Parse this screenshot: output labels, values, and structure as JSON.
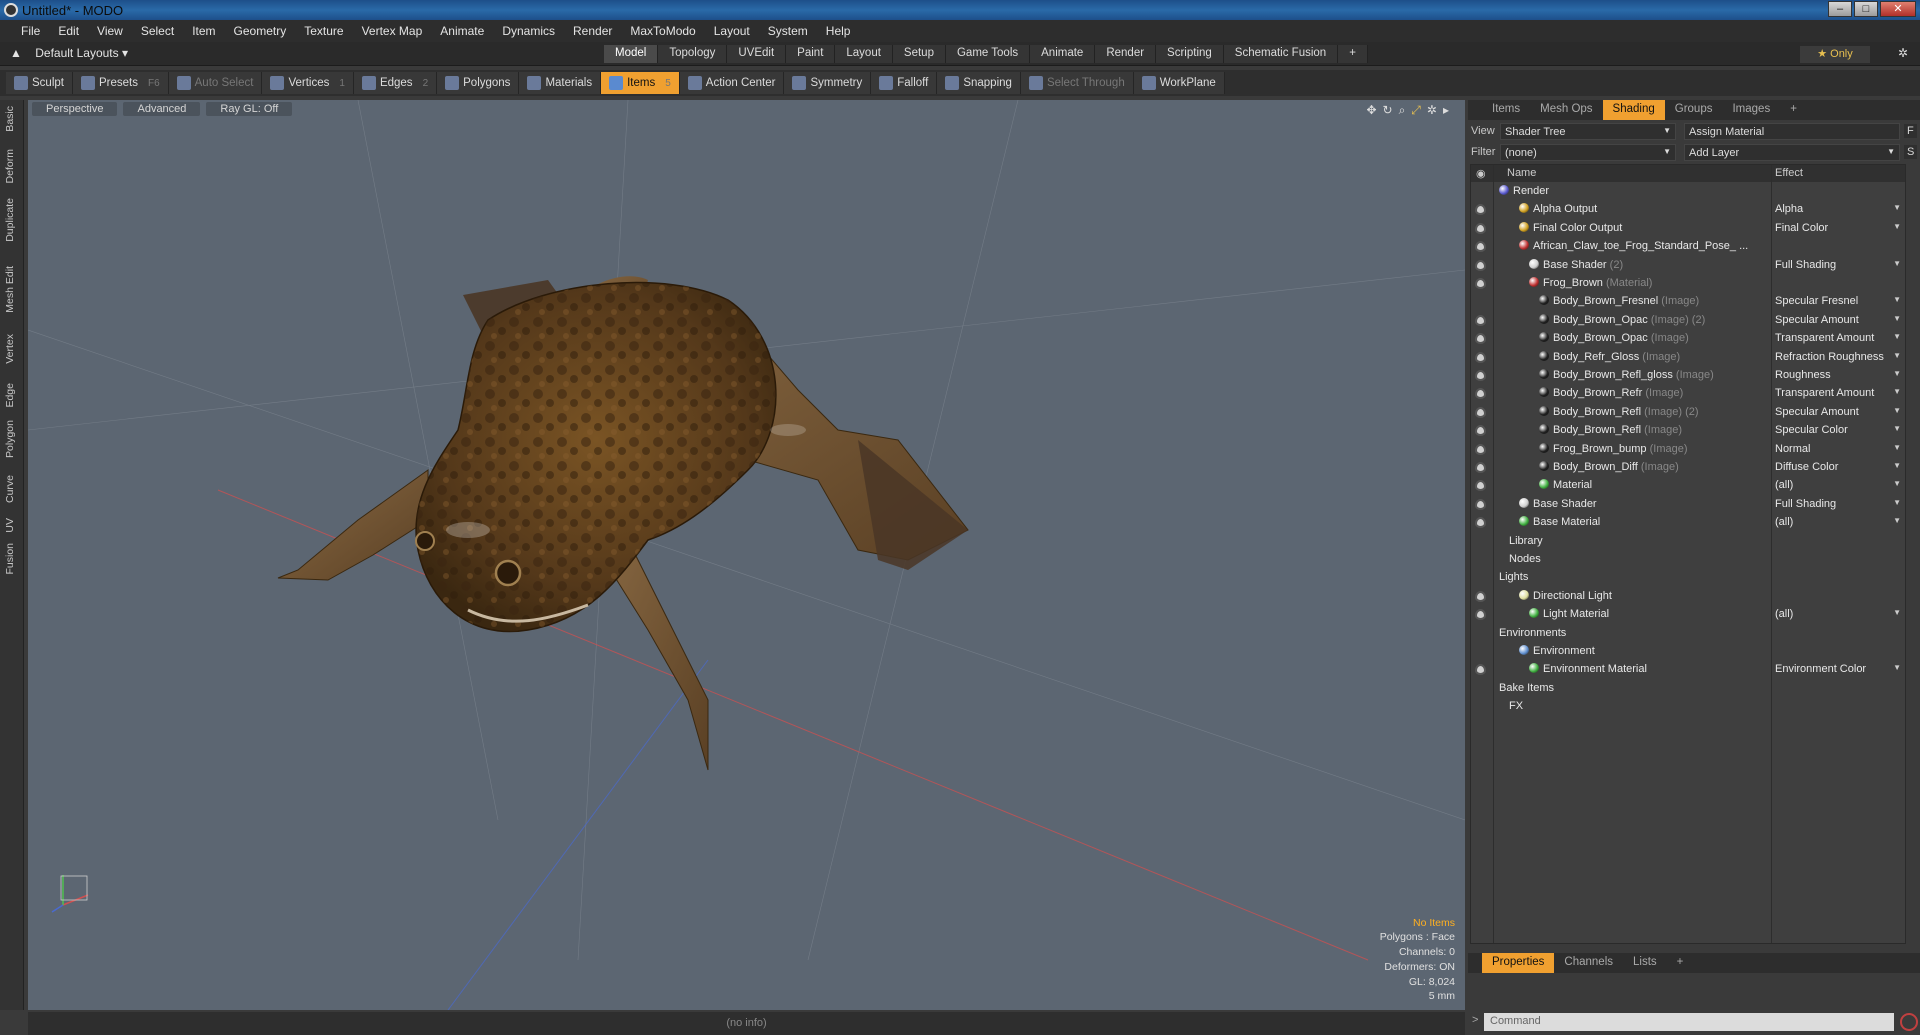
{
  "window": {
    "title": "Untitled* - MODO",
    "buttons": [
      "–",
      "□",
      "✕"
    ]
  },
  "menubar": [
    "File",
    "Edit",
    "View",
    "Select",
    "Item",
    "Geometry",
    "Texture",
    "Vertex Map",
    "Animate",
    "Dynamics",
    "Render",
    "MaxToModo",
    "Layout",
    "System",
    "Help"
  ],
  "layout": {
    "selector": "Default Layouts ▾",
    "tabs": [
      "Model",
      "Topology",
      "UVEdit",
      "Paint",
      "Layout",
      "Setup",
      "Game Tools",
      "Animate",
      "Render",
      "Scripting",
      "Schematic Fusion",
      "+"
    ],
    "active_tab": "Model",
    "only_label": "★ Only"
  },
  "toolbar": {
    "items": [
      {
        "label": "Sculpt",
        "hot": "",
        "state": "normal",
        "icon": "brush-icon"
      },
      {
        "label": "Presets",
        "hot": "F6",
        "state": "normal",
        "icon": "presets-icon"
      },
      {
        "label": "Auto Select",
        "hot": "",
        "state": "disabled",
        "icon": "auto-select-icon"
      },
      {
        "label": "Vertices",
        "hot": "1",
        "state": "normal",
        "icon": "vertices-icon"
      },
      {
        "label": "Edges",
        "hot": "2",
        "state": "normal",
        "icon": "edges-icon"
      },
      {
        "label": "Polygons",
        "hot": "",
        "state": "normal",
        "icon": "polygons-icon"
      },
      {
        "label": "Materials",
        "hot": "",
        "state": "normal",
        "icon": "materials-icon"
      },
      {
        "label": "Items",
        "hot": "5",
        "state": "active",
        "icon": "items-icon"
      },
      {
        "label": "Action Center",
        "hot": "",
        "state": "normal",
        "icon": "action-center-icon"
      },
      {
        "label": "Symmetry",
        "hot": "",
        "state": "normal",
        "icon": "symmetry-icon"
      },
      {
        "label": "Falloff",
        "hot": "",
        "state": "normal",
        "icon": "falloff-icon"
      },
      {
        "label": "Snapping",
        "hot": "",
        "state": "normal",
        "icon": "snapping-icon"
      },
      {
        "label": "Select Through",
        "hot": "",
        "state": "disabled",
        "icon": "select-through-icon"
      },
      {
        "label": "WorkPlane",
        "hot": "",
        "state": "normal",
        "icon": "workplane-icon"
      }
    ]
  },
  "side_tabs": [
    "Basic",
    "Deform",
    "Duplicate",
    "Mesh Edit",
    "Vertex",
    "Edge",
    "Polygon",
    "Curve",
    "UV",
    "Fusion"
  ],
  "viewport": {
    "headers": [
      "Perspective",
      "Advanced",
      "Ray GL: Off"
    ],
    "info": {
      "no_items": "No Items",
      "polygons": "Polygons : Face",
      "channels": "Channels: 0",
      "deformers": "Deformers: ON",
      "gl": "GL: 8,024",
      "scale": "5 mm"
    }
  },
  "statusbar": {
    "text": "(no info)"
  },
  "panel": {
    "tabs": [
      "Items",
      "Mesh Ops",
      "Shading",
      "Groups",
      "Images",
      "+"
    ],
    "active_tab": "Shading",
    "view_label": "View",
    "view_value": "Shader Tree",
    "assign_material": "Assign Material",
    "filter_label": "Filter",
    "filter_value": "(none)",
    "add_layer": "Add Layer",
    "columns": {
      "name": "Name",
      "effect": "Effect"
    },
    "rows": [
      {
        "name": "Render",
        "sub": "",
        "effect": "",
        "indent": 0,
        "eye": false,
        "ball": "#5a5ad0"
      },
      {
        "name": "Alpha Output",
        "sub": "",
        "effect": "Alpha",
        "indent": 2,
        "eye": true,
        "ball": "#d0a020"
      },
      {
        "name": "Final Color Output",
        "sub": "",
        "effect": "Final Color",
        "indent": 2,
        "eye": true,
        "ball": "#d0a020"
      },
      {
        "name": "African_Claw_toe_Frog_Standard_Pose_ ...",
        "sub": "",
        "effect": "",
        "indent": 2,
        "eye": true,
        "ball": "#c03030"
      },
      {
        "name": "Base Shader",
        "sub": "(2)",
        "effect": "Full Shading",
        "indent": 3,
        "eye": true,
        "ball": "#d0d0d0"
      },
      {
        "name": "Frog_Brown",
        "sub": "(Material)",
        "effect": "",
        "indent": 3,
        "eye": true,
        "ball": "#c03030"
      },
      {
        "name": "Body_Brown_Fresnel",
        "sub": "(Image)",
        "effect": "Specular Fresnel",
        "indent": 4,
        "eye": false,
        "ball": "#202020"
      },
      {
        "name": "Body_Brown_Opac",
        "sub": "(Image) (2)",
        "effect": "Specular Amount",
        "indent": 4,
        "eye": true,
        "ball": "#202020"
      },
      {
        "name": "Body_Brown_Opac",
        "sub": "(Image)",
        "effect": "Transparent Amount",
        "indent": 4,
        "eye": true,
        "ball": "#202020"
      },
      {
        "name": "Body_Refr_Gloss",
        "sub": "(Image)",
        "effect": "Refraction Roughness",
        "indent": 4,
        "eye": true,
        "ball": "#202020"
      },
      {
        "name": "Body_Brown_Refl_gloss",
        "sub": "(Image)",
        "effect": "Roughness",
        "indent": 4,
        "eye": true,
        "ball": "#202020"
      },
      {
        "name": "Body_Brown_Refr",
        "sub": "(Image)",
        "effect": "Transparent Amount",
        "indent": 4,
        "eye": true,
        "ball": "#202020"
      },
      {
        "name": "Body_Brown_Refl",
        "sub": "(Image) (2)",
        "effect": "Specular Amount",
        "indent": 4,
        "eye": true,
        "ball": "#202020"
      },
      {
        "name": "Body_Brown_Refl",
        "sub": "(Image)",
        "effect": "Specular Color",
        "indent": 4,
        "eye": true,
        "ball": "#202020"
      },
      {
        "name": "Frog_Brown_bump",
        "sub": "(Image)",
        "effect": "Normal",
        "indent": 4,
        "eye": true,
        "ball": "#202020"
      },
      {
        "name": "Body_Brown_Diff",
        "sub": "(Image)",
        "effect": "Diffuse Color",
        "indent": 4,
        "eye": true,
        "ball": "#202020"
      },
      {
        "name": "Material",
        "sub": "",
        "effect": "(all)",
        "indent": 4,
        "eye": true,
        "ball": "#40b040"
      },
      {
        "name": "Base Shader",
        "sub": "",
        "effect": "Full Shading",
        "indent": 2,
        "eye": true,
        "ball": "#d0d0d0"
      },
      {
        "name": "Base Material",
        "sub": "",
        "effect": "(all)",
        "indent": 2,
        "eye": true,
        "ball": "#40b040"
      },
      {
        "name": "Library",
        "sub": "",
        "effect": "",
        "indent": 1,
        "eye": false,
        "ball": ""
      },
      {
        "name": "Nodes",
        "sub": "",
        "effect": "",
        "indent": 1,
        "eye": false,
        "ball": ""
      },
      {
        "name": "Lights",
        "sub": "",
        "effect": "",
        "indent": 0,
        "eye": false,
        "ball": ""
      },
      {
        "name": "Directional Light",
        "sub": "",
        "effect": "",
        "indent": 2,
        "eye": true,
        "ball": "#e0e0a0"
      },
      {
        "name": "Light Material",
        "sub": "",
        "effect": "(all)",
        "indent": 3,
        "eye": true,
        "ball": "#40b040"
      },
      {
        "name": "Environments",
        "sub": "",
        "effect": "",
        "indent": 0,
        "eye": false,
        "ball": ""
      },
      {
        "name": "Environment",
        "sub": "",
        "effect": "",
        "indent": 2,
        "eye": false,
        "ball": "#6090d0"
      },
      {
        "name": "Environment Material",
        "sub": "",
        "effect": "Environment Color",
        "indent": 3,
        "eye": true,
        "ball": "#40b040"
      },
      {
        "name": "Bake Items",
        "sub": "",
        "effect": "",
        "indent": 0,
        "eye": false,
        "ball": ""
      },
      {
        "name": "FX",
        "sub": "",
        "effect": "",
        "indent": 1,
        "eye": false,
        "ball": ""
      }
    ],
    "bottom_tabs": [
      "Properties",
      "Channels",
      "Lists",
      "+"
    ],
    "bottom_active": "Properties",
    "command_placeholder": "Command"
  }
}
